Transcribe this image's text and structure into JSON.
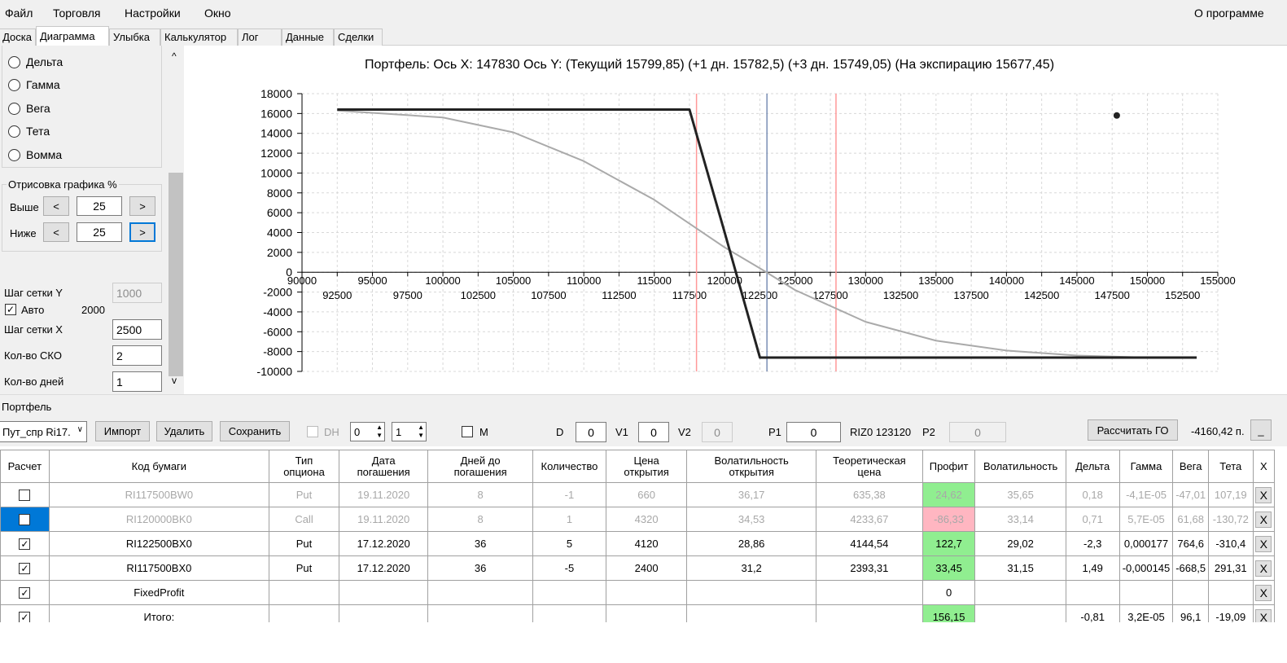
{
  "menu": {
    "file": "Файл",
    "trade": "Торговля",
    "settings": "Настройки",
    "window": "Окно",
    "about": "О программе"
  },
  "tabs": [
    "Доска",
    "Диаграмма",
    "Улыбка",
    "Калькулятор",
    "Лог",
    "Данные",
    "Сделки"
  ],
  "left": {
    "radios": [
      "Дельта",
      "Гамма",
      "Вега",
      "Тета",
      "Вомма"
    ],
    "draw_group": "Отрисовка графика %",
    "above": "Выше",
    "below": "Ниже",
    "above_value": "25",
    "below_value": "25",
    "dec": "<",
    "inc": ">",
    "grid_y": "Шаг сетки Y",
    "grid_y_value": "1000",
    "auto": "Авто",
    "auto_checked": "✓",
    "auto_value": "2000",
    "grid_x": "Шаг сетки X",
    "grid_x_value": "2500",
    "sko": "Кол-во СКО",
    "sko_value": "2",
    "days": "Кол-во дней",
    "days_value": "1",
    "scroll_up": "^",
    "scroll_down": "v"
  },
  "chart_title": "Портфель: Ось X: 147830 Ось Y:  (Текущий 15799,85)  (+1 дн. 15782,5)  (+3 дн. 15749,05)  (На экспирацию 15677,45)",
  "chart_data": {
    "type": "line",
    "ylim": [
      -10000,
      18000
    ],
    "xlim": [
      90000,
      155000
    ],
    "y_ticks": [
      "18000",
      "16000",
      "14000",
      "12000",
      "10000",
      "8000",
      "6000",
      "4000",
      "2000",
      "0",
      "-2000",
      "-4000",
      "-6000",
      "-8000",
      "-10000"
    ],
    "x_ticks_top": [
      "90000",
      "95000",
      "100000",
      "105000",
      "110000",
      "115000",
      "120000",
      "125000",
      "130000",
      "135000",
      "140000",
      "145000",
      "150000",
      "155000"
    ],
    "x_ticks_bottom": [
      "92500",
      "97500",
      "102500",
      "107500",
      "112500",
      "117500",
      "122500",
      "127500",
      "132500",
      "137500",
      "142500",
      "147500",
      "152500"
    ],
    "series": [
      {
        "x": [
          92500,
          117500,
          120000,
          122500,
          153500
        ],
        "y": [
          16400,
          16400,
          4000,
          -8600,
          -8600
        ],
        "color": "#222222"
      },
      {
        "x": [
          92500,
          100000,
          105000,
          110000,
          115000,
          117500,
          120000,
          122500,
          125000,
          130000,
          135000,
          140000,
          145000,
          150000,
          153500
        ],
        "y": [
          16300,
          15600,
          14100,
          11200,
          7300,
          4900,
          2500,
          400,
          -1800,
          -5000,
          -6900,
          -7900,
          -8400,
          -8600,
          -8600
        ],
        "color": "#aaaaaa"
      }
    ],
    "vlines": [
      {
        "x": 118000,
        "color": "#ff9999"
      },
      {
        "x": 123000,
        "color": "#7a8fb5"
      },
      {
        "x": 127900,
        "color": "#ff9999"
      }
    ],
    "point": {
      "x": 147830,
      "y": 15800
    }
  },
  "portfolio": {
    "title": "Портфель",
    "select_value": "Пут_спр Ri17.",
    "import": "Импорт",
    "delete": "Удалить",
    "save": "Сохранить",
    "dh": "DH",
    "dh_val1": "0",
    "dh_val2": "1",
    "m": "M",
    "d_label": "D",
    "d_value": "0",
    "v1_label": "V1",
    "v1_value": "0",
    "v2_label": "V2",
    "v2_value": "0",
    "p1_label": "P1",
    "p1_value": "0",
    "riz": "RIZ0 123120",
    "p2_label": "P2",
    "p2_value": "0",
    "calc_go": "Рассчитать ГО",
    "go_value": "-4160,42 п.",
    "min_btn": "_"
  },
  "grid": {
    "headers": [
      "Расчет",
      "Код бумаги",
      "Тип\nопциона",
      "Дата\nпогашения",
      "Дней до\nпогашения",
      "Количество",
      "Цена\nоткрытия",
      "Волатильность\nоткрытия",
      "Теоретическая\nцена",
      "Профит",
      "Волатильность",
      "Дельта",
      "Гамма",
      "Вега",
      "Тета",
      "X"
    ],
    "rows": [
      {
        "check": "",
        "cells": [
          "RI117500BW0",
          "Put",
          "19.11.2020",
          "8",
          "-1",
          "660",
          "36,17",
          "635,38",
          "24,62",
          "35,65",
          "0,18",
          "-4,1E-05",
          "-47,01",
          "107,19"
        ],
        "x": "X"
      },
      {
        "check": "",
        "cells": [
          "RI120000BK0",
          "Call",
          "19.11.2020",
          "8",
          "1",
          "4320",
          "34,53",
          "4233,67",
          "-86,33",
          "33,14",
          "0,71",
          "5,7E-05",
          "61,68",
          "-130,72"
        ],
        "x": "X"
      },
      {
        "check": "✓",
        "cells": [
          "RI122500BX0",
          "Put",
          "17.12.2020",
          "36",
          "5",
          "4120",
          "28,86",
          "4144,54",
          "122,7",
          "29,02",
          "-2,3",
          "0,000177",
          "764,6",
          "-310,4"
        ],
        "x": "X"
      },
      {
        "check": "✓",
        "cells": [
          "RI117500BX0",
          "Put",
          "17.12.2020",
          "36",
          "-5",
          "2400",
          "31,2",
          "2393,31",
          "33,45",
          "31,15",
          "1,49",
          "-0,000145",
          "-668,5",
          "291,31"
        ],
        "x": "X"
      },
      {
        "check": "✓",
        "cells": [
          "FixedProfit",
          "",
          "",
          "",
          "",
          "",
          "",
          "",
          "0",
          "",
          "",
          "",
          "",
          ""
        ],
        "x": "X"
      },
      {
        "check": "✓",
        "cells": [
          "Итого:",
          "",
          "",
          "",
          "",
          "",
          "",
          "",
          "156,15",
          "",
          "-0,81",
          "3,2E-05",
          "96,1",
          "-19,09"
        ],
        "x": "X"
      }
    ]
  }
}
